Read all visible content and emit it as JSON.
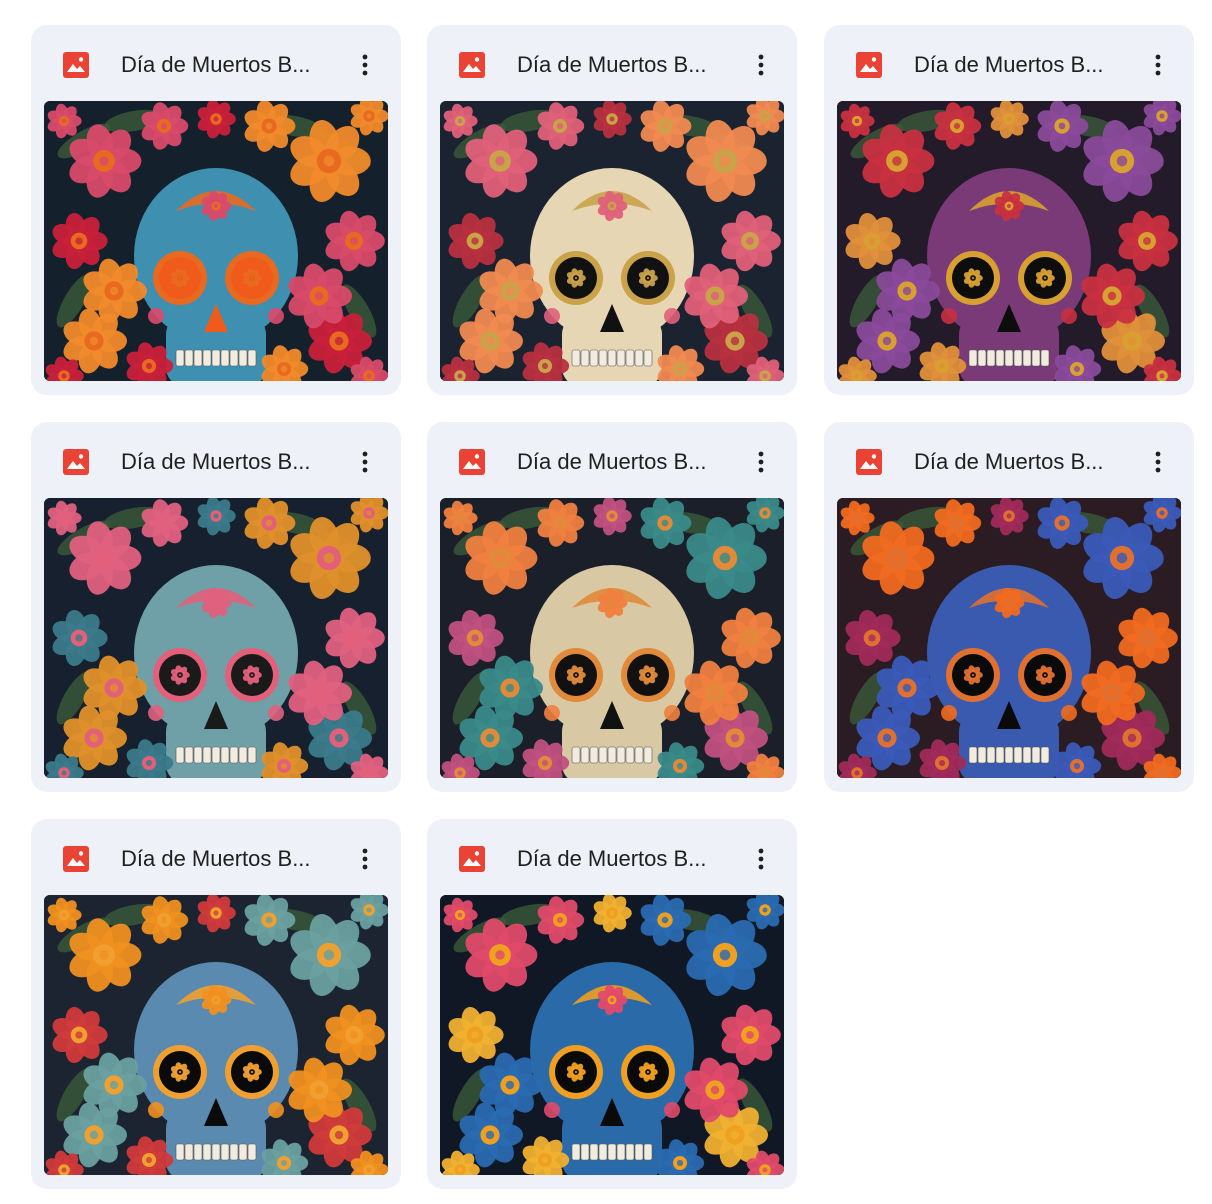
{
  "files": [
    {
      "name": "Día de Muertos B...",
      "thumbnail": "sugar-skull-blue-orange-flowers",
      "palette": {
        "bg": "#14202c",
        "skull": "#3f8fb0",
        "accent": "#e86a20",
        "eye": "#f05a1a",
        "flower1": "#d94a6a",
        "flower2": "#f08a2a",
        "flower3": "#c8203a"
      }
    },
    {
      "name": "Día de Muertos B...",
      "thumbnail": "sugar-skull-cream-gold-crown",
      "palette": {
        "bg": "#1b2230",
        "skull": "#e6d6b4",
        "accent": "#c9a24a",
        "eye": "#111111",
        "flower1": "#e0607a",
        "flower2": "#f08a50",
        "flower3": "#b83040"
      }
    },
    {
      "name": "Día de Muertos B...",
      "thumbnail": "sugar-skull-purple-gold",
      "palette": {
        "bg": "#231a2a",
        "skull": "#7a3a78",
        "accent": "#d8a030",
        "eye": "#0d0d0d",
        "flower1": "#c83040",
        "flower2": "#8a4a9a",
        "flower3": "#e0903a"
      }
    },
    {
      "name": "Día de Muertos B...",
      "thumbnail": "sugar-skull-teal-pink",
      "palette": {
        "bg": "#16202e",
        "skull": "#6fa0a8",
        "accent": "#e2607a",
        "eye": "#1a1a1a",
        "flower1": "#e06080",
        "flower2": "#e0902a",
        "flower3": "#3a7a8a"
      }
    },
    {
      "name": "Día de Muertos B...",
      "thumbnail": "sugar-skull-orange-teal-crown",
      "palette": {
        "bg": "#1a1f2a",
        "skull": "#d9c8a4",
        "accent": "#e08a3a",
        "eye": "#111111",
        "flower1": "#f08040",
        "flower2": "#3a8a8a",
        "flower3": "#c05080"
      }
    },
    {
      "name": "Día de Muertos B...",
      "thumbnail": "sugar-skull-blue-orange-roses",
      "palette": {
        "bg": "#2a1c22",
        "skull": "#3a5ab0",
        "accent": "#e07030",
        "eye": "#0a0a0a",
        "flower1": "#f06a20",
        "flower2": "#3a5ab8",
        "flower3": "#a02a5a"
      }
    },
    {
      "name": "Día de Muertos B...",
      "thumbnail": "sugar-skull-teal-yellow-flower",
      "palette": {
        "bg": "#1c2431",
        "skull": "#5a8ab0",
        "accent": "#f0a030",
        "eye": "#0a0a0a",
        "flower1": "#f09020",
        "flower2": "#6aa0a0",
        "flower3": "#d03a3a"
      }
    },
    {
      "name": "Día de Muertos B...",
      "thumbnail": "sugar-skull-blue-colorful",
      "palette": {
        "bg": "#101826",
        "skull": "#2a6aa8",
        "accent": "#f0a020",
        "eye": "#0a0a0a",
        "flower1": "#e04a6a",
        "flower2": "#2a6ab0",
        "flower3": "#f0b030"
      }
    }
  ]
}
